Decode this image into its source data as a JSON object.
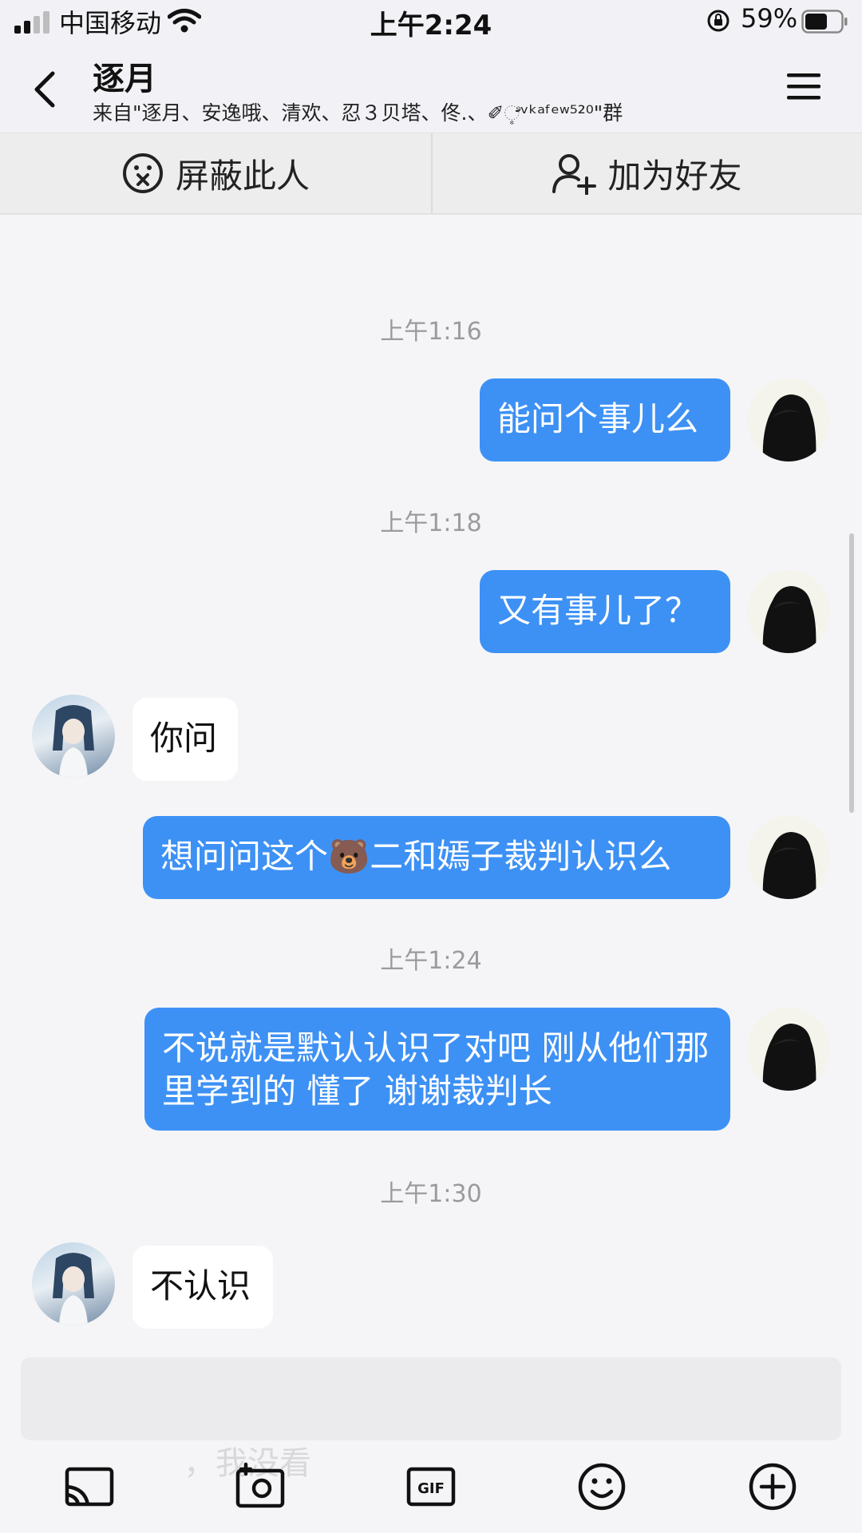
{
  "status_bar": {
    "carrier": "中国移动",
    "time": "上午2:24",
    "battery": "59%"
  },
  "header": {
    "title": "逐月",
    "subtitle": "来自\"逐月、安逸哦、清欢、忍３贝塔、佟.、✐ೆ͙ᵛᵏᵃᶠᵉʷ⁵²⁰\"群"
  },
  "actions": {
    "block": "屏蔽此人",
    "add_friend": "加为好友"
  },
  "messages": [
    {
      "type": "time",
      "text": "上午1:16"
    },
    {
      "type": "out",
      "text": "能问个事儿么"
    },
    {
      "type": "time",
      "text": "上午1:18"
    },
    {
      "type": "out",
      "text": "又有事儿了？"
    },
    {
      "type": "in",
      "text": "你问"
    },
    {
      "type": "out",
      "text": "想问问这个🐻二和嫣子裁判认识么"
    },
    {
      "type": "time",
      "text": "上午1:24"
    },
    {
      "type": "out",
      "text": "不说就是默认认识了对吧 刚从他们那里学到的 懂了 谢谢裁判长"
    },
    {
      "type": "time",
      "text": "上午1:30"
    },
    {
      "type": "in",
      "text": "不认识"
    }
  ],
  "input": {
    "ghost_text": "，我没看"
  },
  "toolbar": [
    "cast-icon",
    "camera-icon",
    "gif-icon",
    "emoji-icon",
    "plus-icon"
  ],
  "colors": {
    "outgoing_bubble": "#3d91f5",
    "incoming_bubble": "#ffffff",
    "background": "#f5f5f7"
  }
}
